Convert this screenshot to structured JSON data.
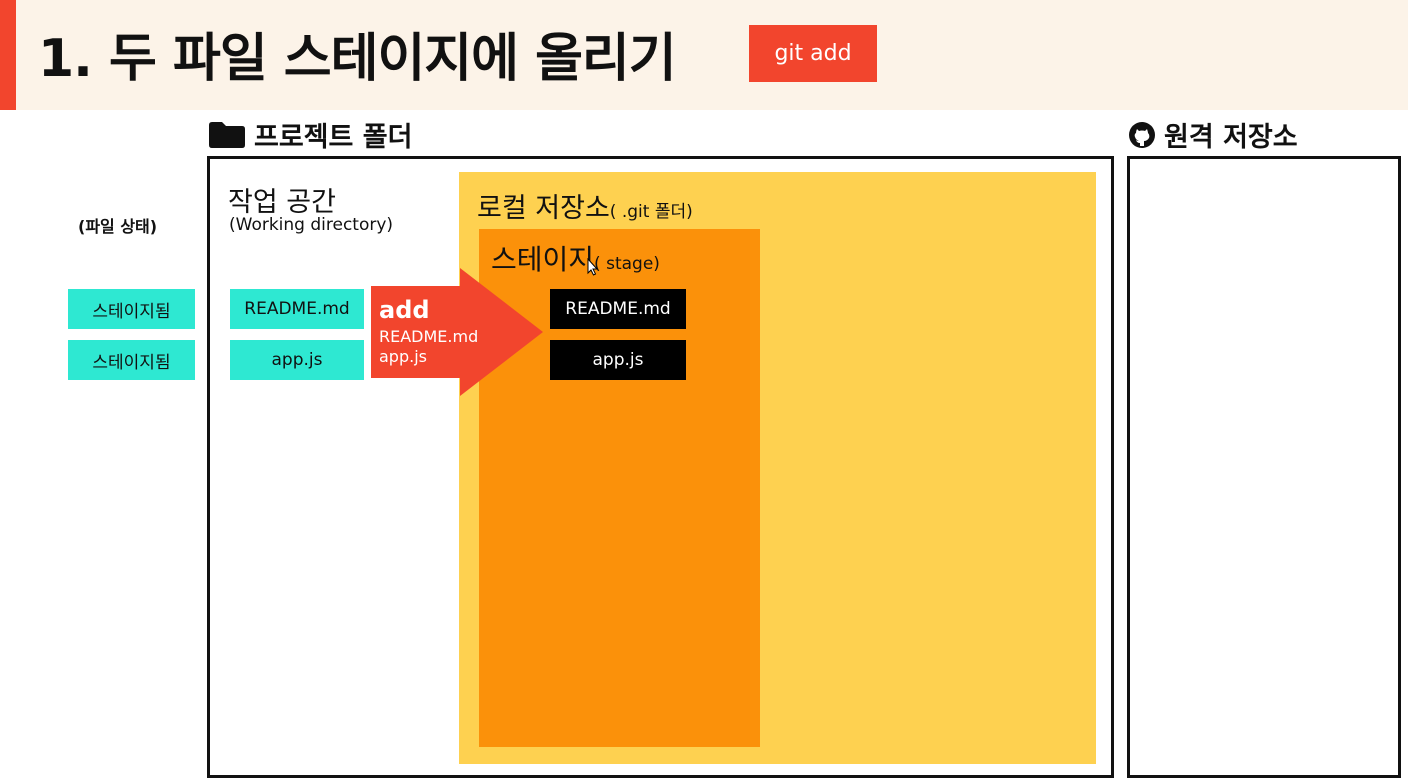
{
  "header": {
    "title": "1. 두 파일 스테이지에 올리기",
    "command": "git add"
  },
  "project_folder": {
    "label": "프로젝트 폴더",
    "icon": "folder-icon"
  },
  "remote_repo": {
    "label": "원격 저장소",
    "icon": "github-icon"
  },
  "file_status": {
    "heading": "(파일 상태)",
    "items": [
      "스테이지됨",
      "스테이지됨"
    ]
  },
  "working_directory": {
    "title": "작업 공간",
    "subtitle": "(Working directory)",
    "files": [
      "README.md",
      "app.js"
    ]
  },
  "local_repo": {
    "title": "로컬 저장소",
    "subtitle": "( .git 폴더)"
  },
  "stage": {
    "title": "스테이지",
    "subtitle": "( stage)",
    "files": [
      "README.md",
      "app.js"
    ]
  },
  "add_arrow": {
    "label": "add",
    "files": [
      "README.md",
      "app.js"
    ]
  },
  "colors": {
    "accent": "#f2452d",
    "header_bg": "#fcf3e8",
    "status_chip": "#2ee8d2",
    "local_repo": "#fed150",
    "stage": "#fb910a",
    "staged_file": "#000000"
  }
}
